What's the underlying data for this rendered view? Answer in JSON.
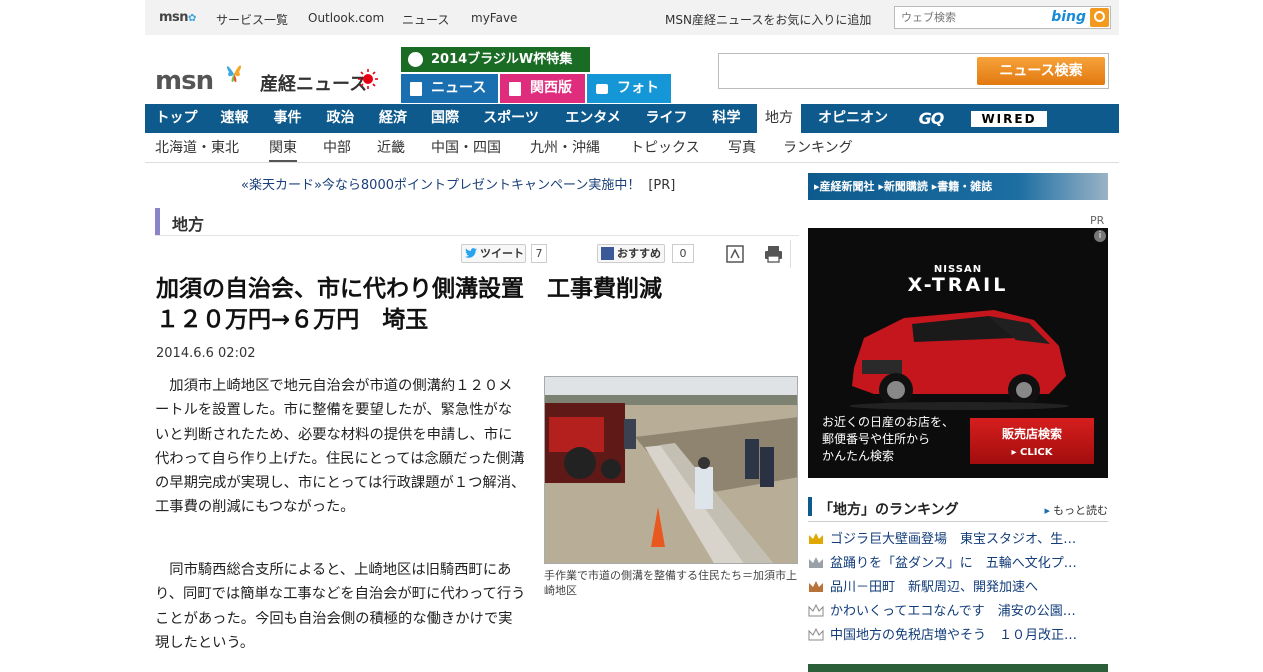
{
  "topbar": {
    "logo": "msn",
    "links": [
      "サービス一覧",
      "Outlook.com",
      "ニュース",
      "myFave"
    ],
    "favorite": "MSN産経ニュースをお気に入りに追加",
    "search_placeholder": "ウェブ検索",
    "search_brand": "bing"
  },
  "header": {
    "msn_logo": "msn",
    "sankei_logo": "産経ニュース",
    "wcup": "2014ブラジルW杯特集",
    "section_tabs": [
      {
        "label": "ニュース",
        "color": "#1a6fb0"
      },
      {
        "label": "関西版",
        "color": "#e02c7d"
      },
      {
        "label": "フォト",
        "color": "#1496d7"
      }
    ],
    "news_search_button": "ニュース検索"
  },
  "main_nav": [
    "トップ",
    "速報",
    "事件",
    "政治",
    "経済",
    "国際",
    "スポーツ",
    "エンタメ",
    "ライフ",
    "科学",
    "地方",
    "オピニオン",
    "GQ",
    "WIRED"
  ],
  "main_nav_active": "地方",
  "sub_nav": [
    "北海道・東北",
    "関東",
    "中部",
    "近畿",
    "中国・四国",
    "九州・沖縄",
    "トピックス",
    "写真",
    "ランキング"
  ],
  "sub_nav_active": "関東",
  "pr_line": {
    "text": "«楽天カード»今なら8000ポイントプレゼントキャンペーン実施中！",
    "tag": "[PR]"
  },
  "section_title": "地方",
  "share": {
    "tweet_label": "ツイート",
    "tweet_count": "7",
    "fb_label": "おすすめ",
    "fb_count": "0"
  },
  "article": {
    "headline_line1": "加須の自治会、市に代わり側溝設置　工事費削減",
    "headline_line2": "１２０万円→６万円　埼玉",
    "date": "2014.6.6 02:02",
    "paragraph1": "加須市上崎地区で地元自治会が市道の側溝約１２０メートルを設置した。市に整備を要望したが、緊急性がないと判断されたため、必要な材料の提供を申請し、市に代わって自ら作り上げた。住民にとっては念願だった側溝の早期完成が実現し、市にとっては行政課題が１つ解消、工事費の削減にもつながった。",
    "paragraph2": "同市騎西総合支所によると、上崎地区は旧騎西町にあり、同町では簡単な工事などを自治会が町に代わって行うことがあった。今回も自治会側の積極的な働きかけで実現したという。",
    "photo_caption": "手作業で市道の側溝を整備する住民たち＝加須市上崎地区"
  },
  "sidebar": {
    "banner": "▸産経新聞社 ▸新聞購読 ▸書籍・雑誌",
    "pr": "PR",
    "ad": {
      "brand": "NISSAN",
      "model": "X-TRAIL",
      "copy_line1": "お近くの日産のお店を、",
      "copy_line2": "郵便番号や住所から",
      "copy_line3": "かんたん検索",
      "cta": "販売店検索",
      "cta_sub": "▸ CLICK",
      "info": "i"
    },
    "ranking_title": "「地方」のランキング",
    "ranking_more": "もっと読む",
    "ranking": [
      {
        "text": "ゴジラ巨大壁画登場　東宝スタジオ、生…",
        "color": "#e0a800"
      },
      {
        "text": "盆踊りを「盆ダンス」に　五輪へ文化プ…",
        "color": "#9aa0a8"
      },
      {
        "text": "品川－田町　新駅周辺、開発加速へ",
        "color": "#b8733a"
      },
      {
        "text": "かわいくってエコなんです　浦安の公園…",
        "color": "#c9c9c9"
      },
      {
        "text": "中国地方の免税店増やそう　１０月改正…",
        "color": "#c9c9c9"
      }
    ]
  }
}
